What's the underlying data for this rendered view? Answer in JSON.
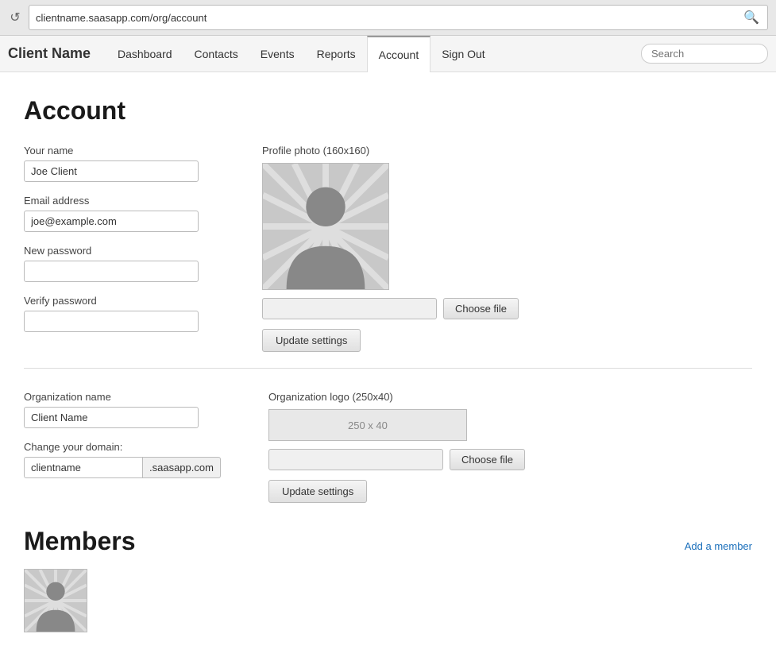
{
  "browser": {
    "url": "clientname.saasapp.com/org/account",
    "back_icon": "↺"
  },
  "nav": {
    "brand": "Client Name",
    "links": [
      {
        "id": "dashboard",
        "label": "Dashboard",
        "active": false
      },
      {
        "id": "contacts",
        "label": "Contacts",
        "active": false
      },
      {
        "id": "events",
        "label": "Events",
        "active": false
      },
      {
        "id": "reports",
        "label": "Reports",
        "active": false
      },
      {
        "id": "account",
        "label": "Account",
        "active": true
      },
      {
        "id": "signout",
        "label": "Sign Out",
        "active": false
      }
    ],
    "search_placeholder": "Search"
  },
  "page": {
    "title": "Account"
  },
  "personal_section": {
    "name_label": "Your name",
    "name_value": "Joe Client",
    "email_label": "Email address",
    "email_value": "joe@example.com",
    "new_password_label": "New password",
    "verify_password_label": "Verify password",
    "photo_label": "Profile photo (160x160)",
    "choose_file_label": "Choose file",
    "update_btn_label": "Update settings"
  },
  "org_section": {
    "org_name_label": "Organization name",
    "org_name_value": "Client Name",
    "domain_label": "Change your domain:",
    "domain_value": "clientname",
    "domain_suffix": ".saasapp.com",
    "org_logo_label": "Organization logo (250x40)",
    "org_logo_placeholder": "250 x 40",
    "choose_file_label": "Choose file",
    "update_btn_label": "Update settings"
  },
  "members_section": {
    "title": "Members",
    "add_member_label": "Add a member"
  }
}
